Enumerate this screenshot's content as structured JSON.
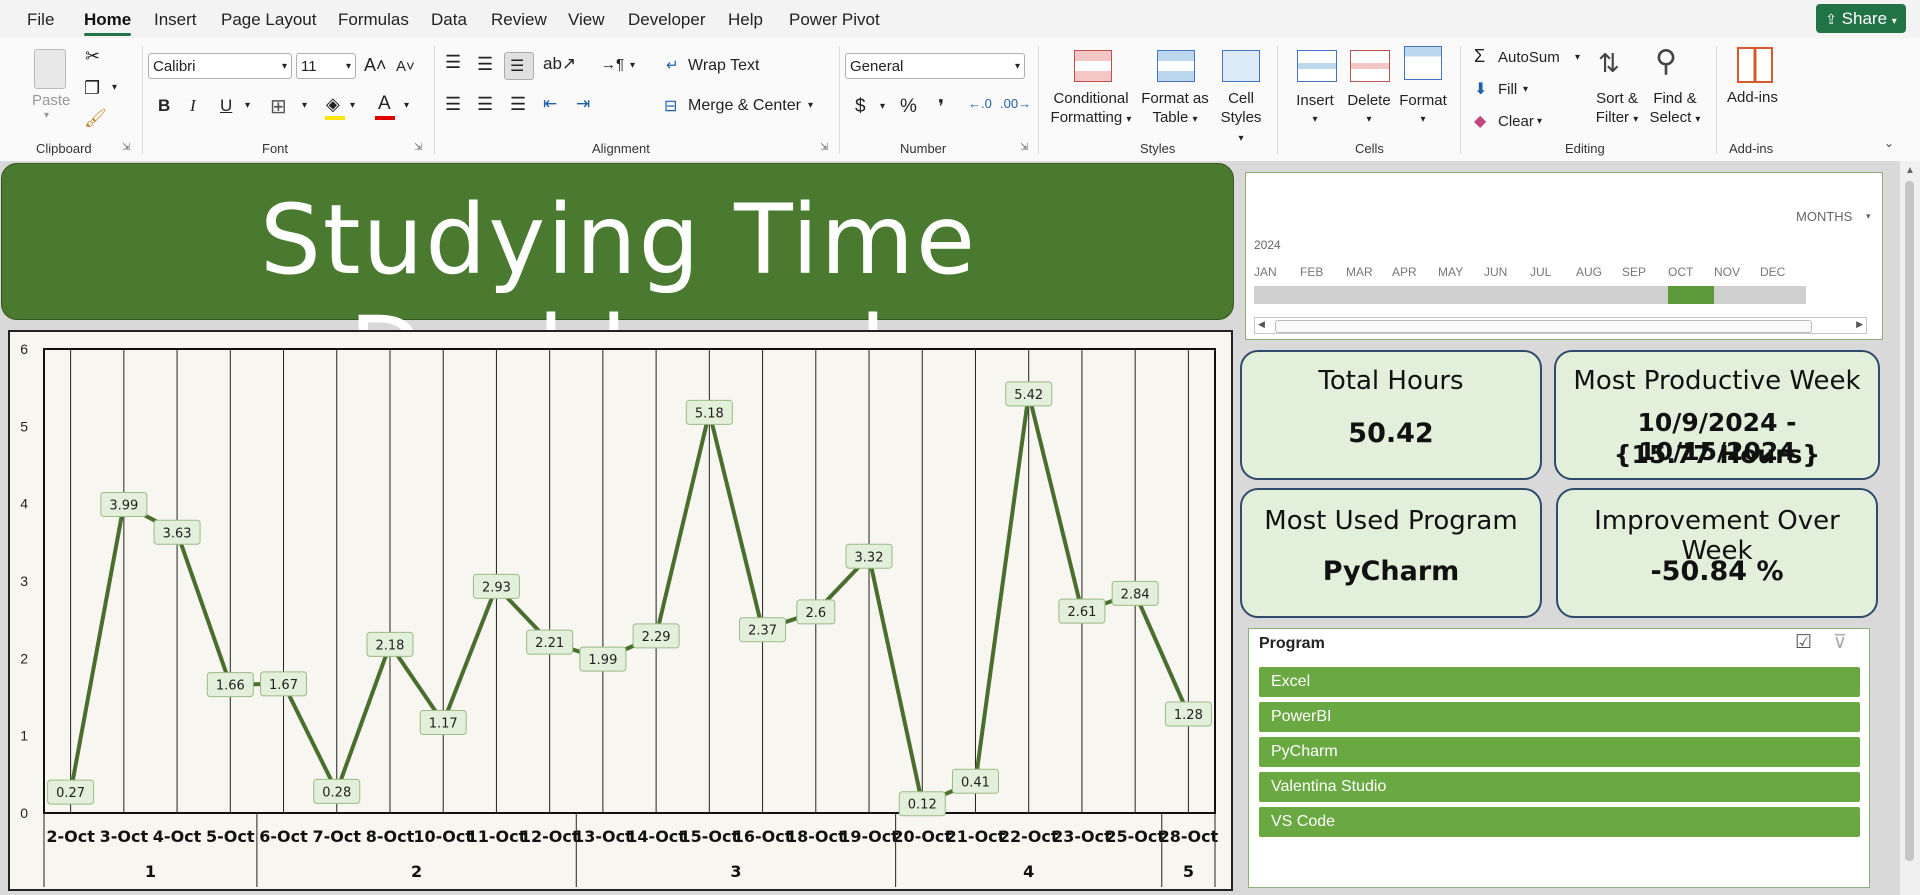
{
  "menu": {
    "items": [
      "File",
      "Home",
      "Insert",
      "Page Layout",
      "Formulas",
      "Data",
      "Review",
      "View",
      "Developer",
      "Help",
      "Power Pivot"
    ],
    "active": "Home",
    "share_label": "Share"
  },
  "ribbon": {
    "clipboard": {
      "paste_label": "Paste",
      "group_label": "Clipboard"
    },
    "font": {
      "name": "Calibri",
      "size": "11",
      "group_label": "Font",
      "bold": "B",
      "italic": "I",
      "underline": "U"
    },
    "alignment": {
      "wrap_text": "Wrap Text",
      "merge_center": "Merge & Center",
      "group_label": "Alignment"
    },
    "number": {
      "format": "General",
      "currency": "$",
      "percent": "%",
      "comma": "❜",
      "group_label": "Number"
    },
    "styles": {
      "conditional_line1": "Conditional",
      "conditional_line2": "Formatting",
      "format_table_line1": "Format as",
      "format_table_line2": "Table",
      "cell_styles_line1": "Cell",
      "cell_styles_line2": "Styles",
      "group_label": "Styles"
    },
    "cells": {
      "insert": "Insert",
      "delete": "Delete",
      "format": "Format",
      "group_label": "Cells"
    },
    "editing": {
      "autosum": "AutoSum",
      "fill": "Fill",
      "clear": "Clear",
      "sort_line1": "Sort &",
      "sort_line2": "Filter",
      "find_line1": "Find &",
      "find_line2": "Select",
      "group_label": "Editing"
    },
    "addins": {
      "label": "Add-ins",
      "group_label": "Add-ins"
    }
  },
  "dashboard": {
    "title": "Studying Time Dashboard"
  },
  "timeline": {
    "level": "MONTHS",
    "year": "2024",
    "months": [
      "JAN",
      "FEB",
      "MAR",
      "APR",
      "MAY",
      "JUN",
      "JUL",
      "AUG",
      "SEP",
      "OCT",
      "NOV",
      "DEC"
    ],
    "selected": "OCT"
  },
  "cards": {
    "total_hours": {
      "title": "Total Hours",
      "value": "50.42"
    },
    "productive_week": {
      "title": "Most Productive Week",
      "value_line1": "10/9/2024 - 10/15/2024",
      "value_line2": "{15.77 Hours}"
    },
    "most_used": {
      "title": "Most Used Program",
      "value": "PyCharm"
    },
    "improvement": {
      "title": "Improvement Over Week",
      "value": "-50.84 %"
    }
  },
  "slicer": {
    "title": "Program",
    "items": [
      "Excel",
      "PowerBI",
      "PyCharm",
      "Valentina Studio",
      "VS Code"
    ]
  },
  "colors": {
    "excel_green": "#217346",
    "banner_green": "#4a7a2f",
    "line_green": "#4a6e2e",
    "label_fill": "#e2efda",
    "slicer_item": "#6aa842",
    "card_border": "#2f4b6b"
  },
  "chart_data": {
    "type": "line",
    "categories": [
      "2-Oct",
      "3-Oct",
      "4-Oct",
      "5-Oct",
      "6-Oct",
      "7-Oct",
      "8-Oct",
      "10-Oct",
      "11-Oct",
      "12-Oct",
      "13-Oct",
      "14-Oct",
      "15-Oct",
      "16-Oct",
      "18-Oct",
      "19-Oct",
      "20-Oct",
      "21-Oct",
      "22-Oct",
      "23-Oct",
      "25-Oct",
      "28-Oct"
    ],
    "weeks": [
      {
        "label": "1",
        "count": 4
      },
      {
        "label": "2",
        "count": 6
      },
      {
        "label": "3",
        "count": 6
      },
      {
        "label": "4",
        "count": 5
      },
      {
        "label": "5",
        "count": 1
      }
    ],
    "values": [
      0.27,
      3.99,
      3.63,
      1.66,
      1.67,
      0.28,
      2.18,
      1.17,
      2.93,
      2.21,
      1.99,
      2.29,
      5.18,
      2.37,
      2.6,
      3.32,
      0.12,
      0.41,
      5.42,
      2.61,
      2.84,
      1.28
    ],
    "value_labels": [
      "0.27",
      "3.99",
      "3.63",
      "1.66",
      "1.67",
      "0.28",
      "2.18",
      "1.17",
      "2.93",
      "2.21",
      "1.99",
      "2.29",
      "5.18",
      "2.37",
      "2.6",
      "3.32",
      "0.12",
      "0.41",
      "5.42",
      "2.61",
      "2.84",
      "1.28"
    ],
    "yticks": [
      "0",
      "1",
      "2",
      "3",
      "4",
      "5",
      "6"
    ],
    "ylim": [
      0,
      6
    ],
    "grid": "vertical",
    "legend": "none"
  }
}
